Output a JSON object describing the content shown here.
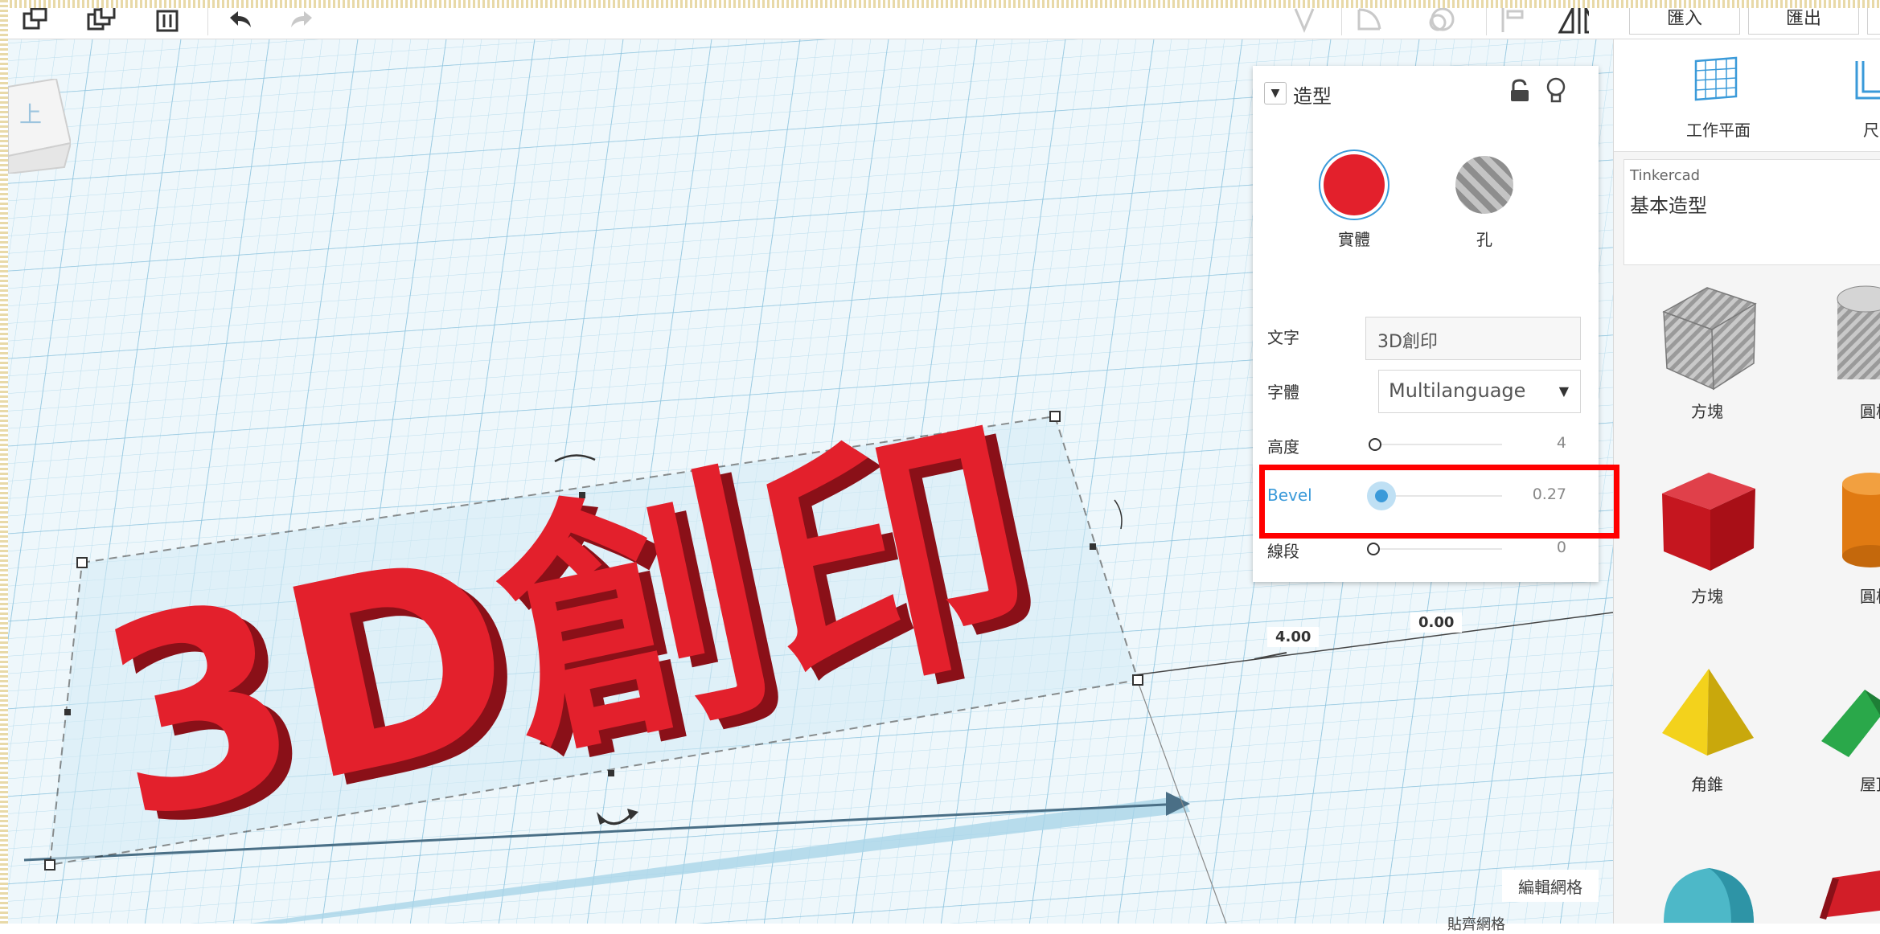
{
  "toolbar": {
    "import_label": "匯入",
    "export_label": "匯出"
  },
  "view_cube": {
    "top_label": "上"
  },
  "inspector": {
    "title": "造型",
    "solid_label": "實體",
    "hole_label": "孔",
    "text_label": "文字",
    "text_value": "3D創印",
    "font_label": "字體",
    "font_value": "Multilanguage",
    "height_label": "高度",
    "height_value": "4",
    "height_level": 0.0,
    "bevel_label": "Bevel",
    "bevel_value": "0.27",
    "bevel_level": 0.05,
    "segments_label": "線段",
    "segments_value": "0",
    "segments_level": 0.0,
    "solid_color": "#e3202c"
  },
  "workplane": {
    "shape_text": "3D創印",
    "dim_height": "4.00",
    "dim_elevation": "0.00",
    "edit_grid_label": "編輯網格",
    "snap_label": "貼齊網格"
  },
  "right_panel": {
    "workplane_button": "工作平面",
    "ruler_button": "尺",
    "library_source": "Tinkercad",
    "library_name": "基本造型",
    "shapes": [
      {
        "label": "方塊"
      },
      {
        "label": "圓柱"
      },
      {
        "label": "方塊"
      },
      {
        "label": "圓柱"
      },
      {
        "label": "角錐"
      },
      {
        "label": "屋頂"
      }
    ]
  },
  "colors": {
    "accent_blue": "#3a9ad9",
    "shape_red": "#e3202c",
    "grid_bg": "#eaf4f9",
    "highlight": "#ff0000"
  }
}
